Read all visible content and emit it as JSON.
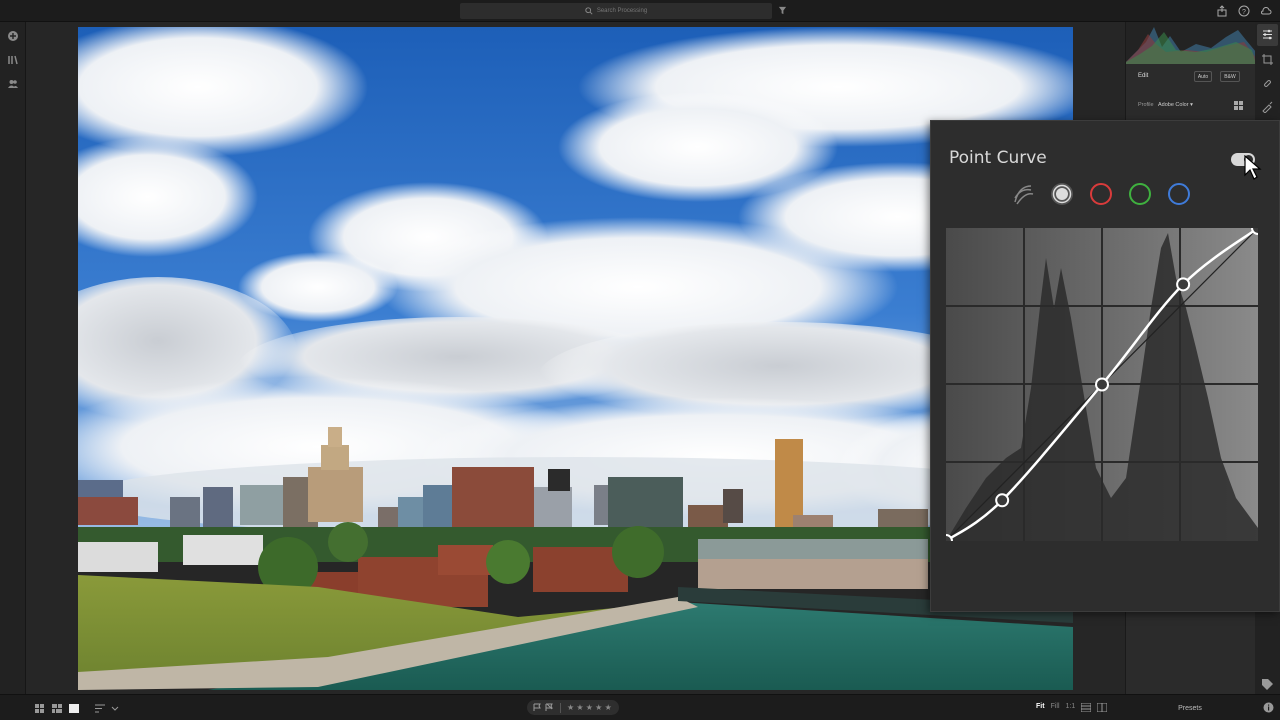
{
  "topbar": {
    "search_placeholder": "Search Processing"
  },
  "right_panel": {
    "edit_label": "Edit",
    "auto_label": "Auto",
    "bw_label": "B&W",
    "profile_label": "Profile",
    "profile_value": "Adobe Color ▾"
  },
  "point_curve": {
    "title": "Point Curve",
    "enabled": true,
    "channels": [
      "parametric-curve",
      "rgb",
      "red",
      "green",
      "blue"
    ],
    "selected_channel": "rgb",
    "channel_colors": {
      "red": "#d93b3b",
      "green": "#3fb13f",
      "blue": "#3f7bd9",
      "rgb": "#d8d8d8"
    },
    "curve_points": [
      [
        0,
        0
      ],
      [
        0.18,
        0.13
      ],
      [
        0.5,
        0.5
      ],
      [
        0.76,
        0.82
      ],
      [
        1,
        1
      ]
    ]
  },
  "bottombar": {
    "rating_stars": "★ ★ ★ ★ ★",
    "fit": "Fit",
    "fill": "Fill",
    "one_to_one": "1:1",
    "presets": "Presets"
  },
  "colors": {
    "accent_text": "#d8d8d8",
    "panel_bg": "#2d2d2d",
    "app_bg": "#252525"
  }
}
